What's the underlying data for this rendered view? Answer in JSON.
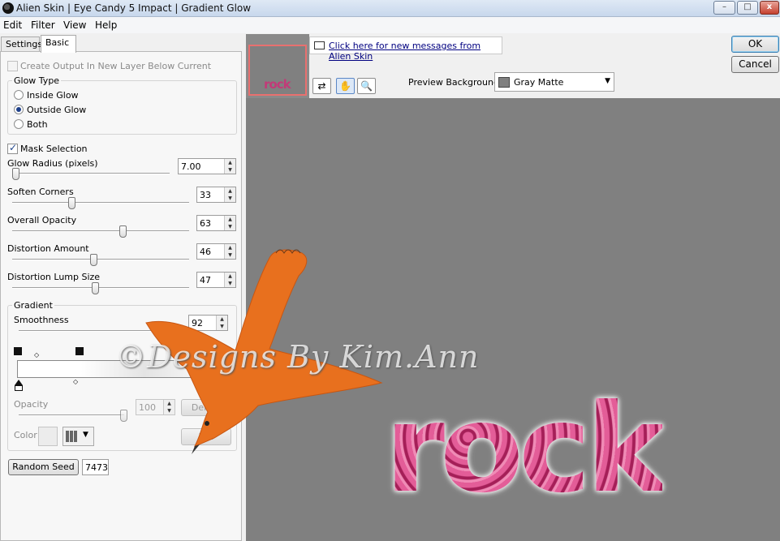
{
  "window": {
    "title": "Alien Skin | Eye Candy 5 Impact | Gradient Glow",
    "minimize_label": "–",
    "maximize_label": "□",
    "close_label": "x"
  },
  "menu": [
    "Edit",
    "Filter",
    "View",
    "Help"
  ],
  "tabs": [
    "Settings",
    "Basic"
  ],
  "controls": {
    "create_output_label": "Create Output In New Layer Below Current",
    "glow_type_title": "Glow Type",
    "glow_types": [
      "Inside Glow",
      "Outside Glow",
      "Both"
    ],
    "selected_glow_type": "Outside Glow",
    "mask_selection_label": "Mask Selection",
    "mask_selection_checked": true,
    "sliders": [
      {
        "label": "Glow Radius (pixels)",
        "value": "7.00",
        "fraction": 0.0
      },
      {
        "label": "Soften Corners",
        "value": "33",
        "fraction": 0.33
      },
      {
        "label": "Overall Opacity",
        "value": "63",
        "fraction": 0.63
      },
      {
        "label": "Distortion Amount",
        "value": "46",
        "fraction": 0.46
      },
      {
        "label": "Distortion Lump Size",
        "value": "47",
        "fraction": 0.47
      }
    ],
    "gradient": {
      "title": "Gradient",
      "smoothness_label": "Smoothness",
      "smoothness_value": "92",
      "opacity_label": "Opacity",
      "opacity_value": "100",
      "delete_label": "Delete",
      "color_label": "Color",
      "d_button_label": "D..."
    },
    "random_seed_label": "Random Seed",
    "random_seed_value": "7473"
  },
  "preview": {
    "thumbnail_text": "rock",
    "message_link": "Click here for new messages from Alien Skin",
    "background_label": "Preview Background:",
    "background_value": "Gray Matte",
    "background_color": "#7f7f7f",
    "canvas_text": "rock"
  },
  "buttons": {
    "ok": "OK",
    "cancel": "Cancel"
  },
  "watermark": "©Designs By Kim.Ann",
  "colors": {
    "canvas": "#808080",
    "bird": "#e8701e",
    "text_pink": "#cf3f80",
    "thumb_border": "#e8706f"
  }
}
